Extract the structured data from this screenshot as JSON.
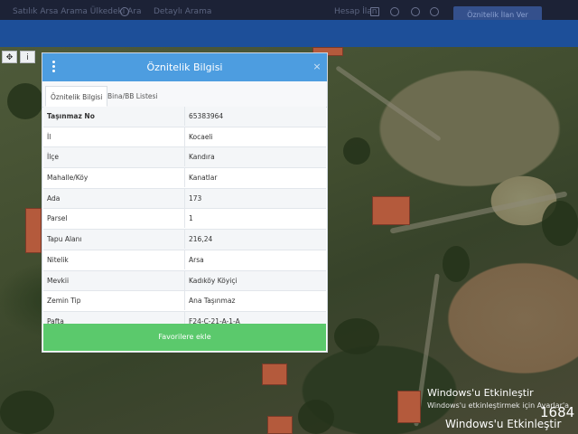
{
  "topbar": {
    "faded_left": "Satılık Arsa Arama Ülkedeki Ara",
    "faded_mid": "Detaylı Arama",
    "faded_right": "Hesap İlan",
    "action_button": "Öznitelik İlan Ver"
  },
  "tools": {
    "move_icon": "move-icon",
    "info_icon": "info-icon",
    "info_glyph": "i",
    "move_glyph": "✥"
  },
  "dialog": {
    "title": "Öznitelik Bilgisi",
    "close_glyph": "×",
    "tabs": [
      "Öznitelik Bilgisi",
      "Bina/BB Listesi"
    ],
    "rows": [
      {
        "key": "Taşınmaz No",
        "value": "65383964"
      },
      {
        "key": "İl",
        "value": "Kocaeli"
      },
      {
        "key": "İlçe",
        "value": "Kandıra"
      },
      {
        "key": "Mahalle/Köy",
        "value": "Kanatlar"
      },
      {
        "key": "Ada",
        "value": "173"
      },
      {
        "key": "Parsel",
        "value": "1"
      },
      {
        "key": "Tapu Alanı",
        "value": "216,24"
      },
      {
        "key": "Nitelik",
        "value": "Arsa"
      },
      {
        "key": "Mevkii",
        "value": "Kadıköy Köyiçi"
      },
      {
        "key": "Zemin Tip",
        "value": "Ana Taşınmaz"
      },
      {
        "key": "Pafta",
        "value": "F24-C-21-A-1-A"
      }
    ],
    "favorite_button": "Favorilere ekle"
  },
  "watermark": {
    "line1": "Windows'u Etkinleştir",
    "line2": "Windows'u etkinleştirmek için Ayarlar'a",
    "line3": "Windows'u Etkinleştir",
    "number": "1684"
  },
  "colors": {
    "header_blue": "#4d9de0",
    "favorite_green": "#5bc96c",
    "topbar": "#1c2236",
    "band": "#1d4f99"
  }
}
